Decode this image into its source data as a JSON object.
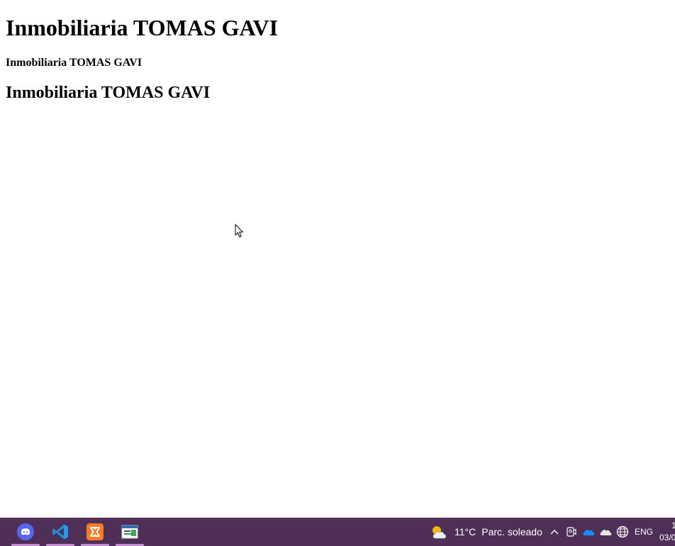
{
  "page": {
    "heading_h1": "Inmobiliaria TOMAS GAVI",
    "heading_h4": "Inmobiliaria TOMAS GAVI",
    "heading_h2": "Inmobiliaria TOMAS GAVI"
  },
  "taskbar": {
    "background": "#4d2f57",
    "apps": [
      {
        "name": "discord",
        "icon": "discord-icon",
        "color": "#5865f2",
        "active": true
      },
      {
        "name": "vscode",
        "icon": "vscode-icon",
        "color": "#2489ca",
        "active": true
      },
      {
        "name": "xampp",
        "icon": "xampp-icon",
        "color": "#fb7a24",
        "active": true
      },
      {
        "name": "app",
        "icon": "application-window-icon",
        "color": "#2f9e44",
        "active": true
      }
    ],
    "weather": {
      "icon": "partly-sunny-icon",
      "temperature": "11°C",
      "condition": "Parc. soleado"
    },
    "tray": {
      "icons": [
        "chevron-up-icon",
        "meet-now-icon",
        "onedrive-icon",
        "onedrive-personal-icon",
        "network-globe-icon"
      ],
      "language": "ENG"
    },
    "clock": {
      "time": "1",
      "date": "03/0"
    }
  }
}
